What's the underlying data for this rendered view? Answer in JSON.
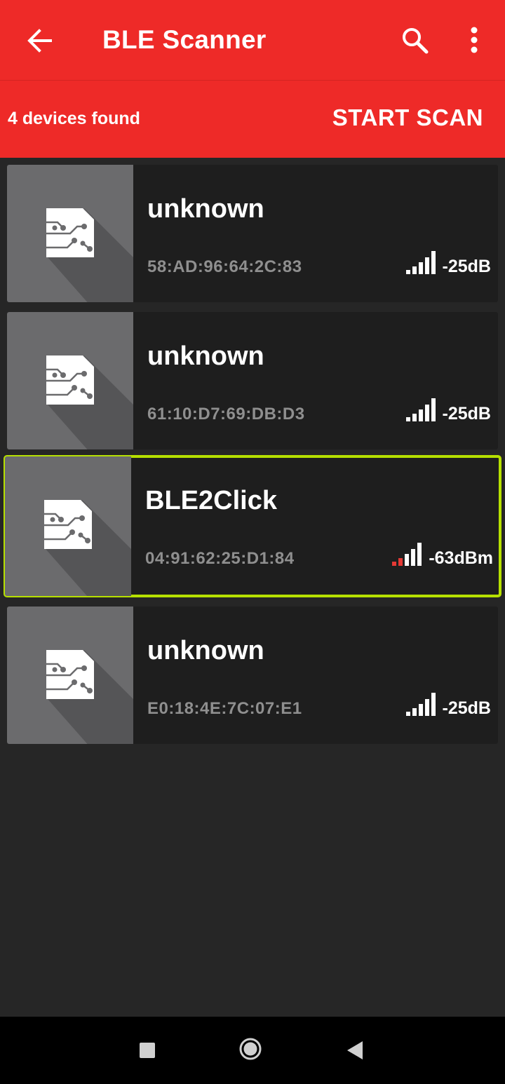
{
  "appbar": {
    "title": "BLE Scanner",
    "back_icon": "arrow-back-icon",
    "search_icon": "search-icon",
    "more_icon": "more-vert-icon"
  },
  "scanbar": {
    "count_label": "4 devices found",
    "start_label": "START SCAN"
  },
  "devices": [
    {
      "name": "unknown",
      "mac": "58:AD:96:64:2C:83",
      "rssi": "-25dB",
      "signal_level": 5,
      "signal_color": "#ffffff",
      "selected": false
    },
    {
      "name": "unknown",
      "mac": "61:10:D7:69:DB:D3",
      "rssi": "-25dB",
      "signal_level": 5,
      "signal_color": "#ffffff",
      "selected": false
    },
    {
      "name": "BLE2Click",
      "mac": "04:91:62:25:D1:84",
      "rssi": "-63dBm",
      "signal_level": 3,
      "signal_color": "#e53935",
      "selected": true
    },
    {
      "name": "unknown",
      "mac": "E0:18:4E:7C:07:E1",
      "rssi": "-25dB",
      "signal_level": 5,
      "signal_color": "#ffffff",
      "selected": false
    }
  ],
  "colors": {
    "accent": "#ee2a28",
    "selection_outline": "#b6e000",
    "card_bg": "#1e1e1e",
    "screen_bg": "#262626"
  },
  "navbar": {
    "recent_icon": "recents-square-icon",
    "home_icon": "home-circle-icon",
    "back_icon": "back-triangle-icon"
  }
}
